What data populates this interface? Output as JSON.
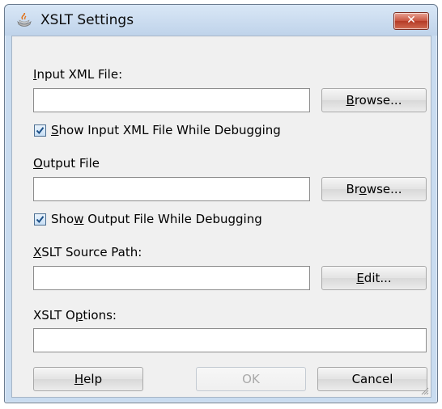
{
  "window": {
    "title": "XSLT Settings",
    "close_glyph": "✕"
  },
  "input_xml": {
    "label_mnemonic": "I",
    "label_rest": "nput XML File:",
    "value": "",
    "browse_pre": "",
    "browse_mn": "B",
    "browse_post": "rowse...",
    "checkbox_checked": true,
    "checkbox_mnemonic": "S",
    "checkbox_rest": "how Input XML File While Debugging"
  },
  "output_file": {
    "label_mnemonic": "O",
    "label_rest": "utput File",
    "value": "",
    "browse_pre": "Br",
    "browse_mn": "o",
    "browse_post": "wse...",
    "checkbox_checked": true,
    "checkbox_pre": "Sho",
    "checkbox_mnemonic": "w",
    "checkbox_rest": " Output File While Debugging"
  },
  "xslt_source": {
    "label_mnemonic": "X",
    "label_rest": "SLT Source Path:",
    "value": "",
    "edit_mn": "E",
    "edit_post": "dit..."
  },
  "xslt_options": {
    "label_pre": "XSLT O",
    "label_mnemonic": "p",
    "label_rest": "tions:",
    "value": ""
  },
  "buttons": {
    "help_mn": "H",
    "help_post": "elp",
    "ok": "OK",
    "cancel": "Cancel"
  },
  "icons": [
    "java-cup-icon",
    "close-icon",
    "checkbox-check-icon",
    "resize-grip-icon"
  ]
}
